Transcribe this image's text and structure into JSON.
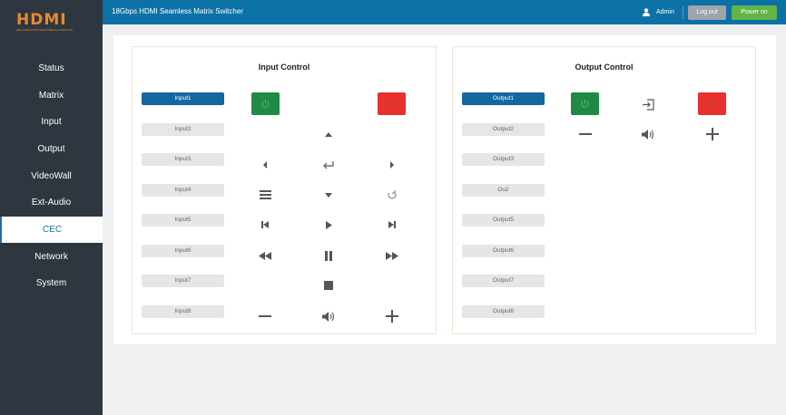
{
  "brand": {
    "logo_text": "HDMI",
    "logo_sub": "HIGH-DEFINITION MULTIMEDIA INTERFACE"
  },
  "sidebar": {
    "items": [
      {
        "label": "Status"
      },
      {
        "label": "Matrix"
      },
      {
        "label": "Input"
      },
      {
        "label": "Output"
      },
      {
        "label": "VideoWall"
      },
      {
        "label": "Ext-Audio"
      },
      {
        "label": "CEC",
        "active": true
      },
      {
        "label": "Network"
      },
      {
        "label": "System"
      }
    ]
  },
  "header": {
    "title": "18Gbps HDMI Seamless Matrix Switcher",
    "user": "Admin",
    "logout": "Log out",
    "power_on": "Power on"
  },
  "colors": {
    "accent": "#0c72a6",
    "power_on": "#1e8a44",
    "power_off": "#e8302c",
    "sidebar": "#2e373f"
  },
  "input_control": {
    "title": "Input Control",
    "inputs": [
      "Input1",
      "Input2",
      "Input3",
      "Input4",
      "Input5",
      "Input6",
      "Input7",
      "Input8"
    ],
    "selected": "Input1"
  },
  "output_control": {
    "title": "Output Control",
    "outputs": [
      "Output1",
      "Output2",
      "Output3",
      "Ou2",
      "Output5",
      "Output6",
      "Output7",
      "Output8"
    ],
    "selected": "Output1"
  }
}
